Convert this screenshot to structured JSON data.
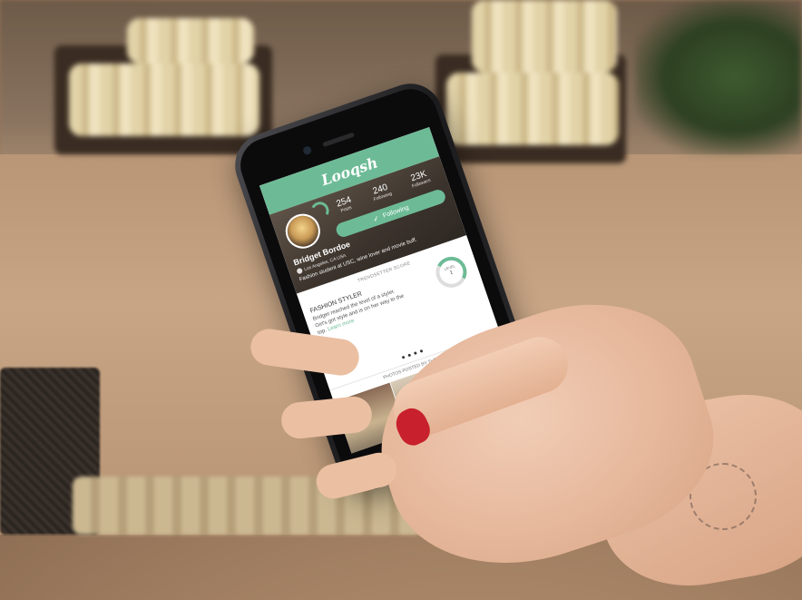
{
  "app": {
    "logo": "Looqsh"
  },
  "profile": {
    "name": "Bridget Bordoe",
    "location": "Los Angeles, CA USA",
    "bio": "Fashion student at USC, wine lover and movie buff.",
    "stats": [
      {
        "value": "254",
        "label": "Posts"
      },
      {
        "value": "240",
        "label": "Following"
      },
      {
        "value": "23K",
        "label": "Followers"
      }
    ],
    "follow_button": "Following"
  },
  "trendsetter": {
    "title": "TRENDSETTER SCORE",
    "style_title": "FASHION STYLER",
    "description": "Bridget reached the level of a styler. Girl's got style and is on her way to the top.",
    "learn_more": "Learn more",
    "level_label": "LEVEL",
    "level_value": "1"
  },
  "photos": {
    "title": "PHOTOS POSTED BY THE USER"
  },
  "colors": {
    "accent": "#6dbb96",
    "nail": "#c8202c"
  }
}
